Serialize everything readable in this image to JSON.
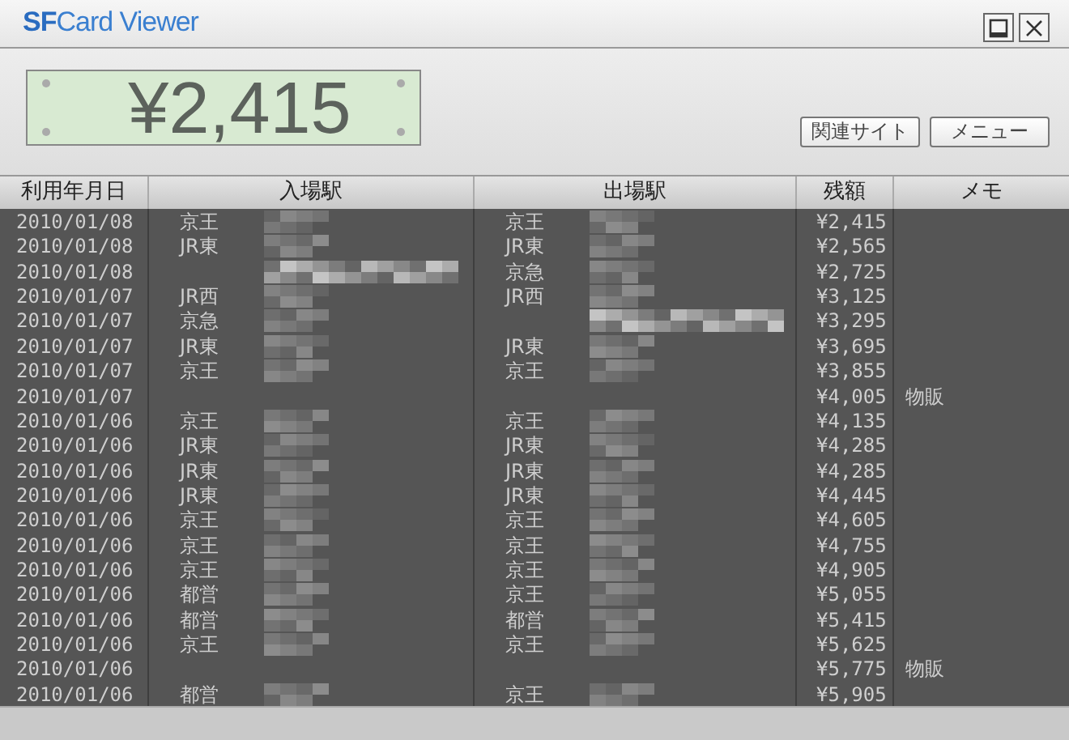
{
  "window": {
    "title_bold": "SF",
    "title_rest": "Card Viewer"
  },
  "balance": "¥2,415",
  "buttons": [
    "関連サイト",
    "メニュー"
  ],
  "table": {
    "columns": [
      "利用年月日",
      "入場駅",
      "出場駅",
      "残額",
      "メモ"
    ],
    "rows": [
      {
        "date": "2010/01/08",
        "entry": "京王",
        "entry_blurred": true,
        "entry_blur_wide": false,
        "exit": "京王",
        "exit_blurred": true,
        "exit_blur_wide": false,
        "balance": "¥2,415"
      },
      {
        "date": "2010/01/08",
        "entry": "JR東",
        "entry_blurred": true,
        "entry_blur_wide": false,
        "exit": "JR東",
        "exit_blurred": true,
        "exit_blur_wide": false,
        "balance": "¥2,565"
      },
      {
        "date": "2010/01/08",
        "entry_blurred": true,
        "entry_blur_wide": true,
        "exit": "京急",
        "exit_blurred": true,
        "exit_blur_wide": false,
        "balance": "¥2,725"
      },
      {
        "date": "2010/01/07",
        "entry": "JR西",
        "entry_blurred": true,
        "entry_blur_wide": false,
        "exit": "JR西",
        "exit_blurred": true,
        "exit_blur_wide": false,
        "balance": "¥3,125"
      },
      {
        "date": "2010/01/07",
        "entry": "京急",
        "entry_blurred": true,
        "entry_blur_wide": false,
        "exit_blurred": true,
        "exit_blur_wide": true,
        "balance": "¥3,295"
      },
      {
        "date": "2010/01/07",
        "entry": "JR東",
        "entry_blurred": true,
        "entry_blur_wide": false,
        "exit": "JR東",
        "exit_blurred": true,
        "exit_blur_wide": false,
        "balance": "¥3,695"
      },
      {
        "date": "2010/01/07",
        "entry": "京王",
        "entry_blurred": true,
        "entry_blur_wide": false,
        "exit": "京王",
        "exit_blurred": true,
        "exit_blur_wide": false,
        "balance": "¥3,855"
      },
      {
        "date": "2010/01/07",
        "entry_blurred": false,
        "exit_blurred": false,
        "balance": "¥4,005",
        "memo": "物販"
      },
      {
        "date": "2010/01/06",
        "entry": "京王",
        "entry_blurred": true,
        "entry_blur_wide": false,
        "exit": "京王",
        "exit_blurred": true,
        "exit_blur_wide": false,
        "balance": "¥4,135"
      },
      {
        "date": "2010/01/06",
        "entry": "JR東",
        "entry_blurred": true,
        "entry_blur_wide": false,
        "exit": "JR東",
        "exit_blurred": true,
        "exit_blur_wide": false,
        "balance": "¥4,285"
      },
      {
        "date": "2010/01/06",
        "entry": "JR東",
        "entry_blurred": true,
        "entry_blur_wide": false,
        "exit": "JR東",
        "exit_blurred": true,
        "exit_blur_wide": false,
        "balance": "¥4,285"
      },
      {
        "date": "2010/01/06",
        "entry": "JR東",
        "entry_blurred": true,
        "entry_blur_wide": false,
        "exit": "JR東",
        "exit_blurred": true,
        "exit_blur_wide": false,
        "balance": "¥4,445"
      },
      {
        "date": "2010/01/06",
        "entry": "京王",
        "entry_blurred": true,
        "entry_blur_wide": false,
        "exit": "京王",
        "exit_blurred": true,
        "exit_blur_wide": false,
        "balance": "¥4,605"
      },
      {
        "date": "2010/01/06",
        "entry": "京王",
        "entry_blurred": true,
        "entry_blur_wide": false,
        "exit": "京王",
        "exit_blurred": true,
        "exit_blur_wide": false,
        "balance": "¥4,755"
      },
      {
        "date": "2010/01/06",
        "entry": "京王",
        "entry_blurred": true,
        "entry_blur_wide": false,
        "exit": "京王",
        "exit_blurred": true,
        "exit_blur_wide": false,
        "balance": "¥4,905"
      },
      {
        "date": "2010/01/06",
        "entry": "都営",
        "entry_blurred": true,
        "entry_blur_wide": false,
        "exit": "京王",
        "exit_blurred": true,
        "exit_blur_wide": false,
        "balance": "¥5,055"
      },
      {
        "date": "2010/01/06",
        "entry": "都営",
        "entry_blurred": true,
        "entry_blur_wide": false,
        "exit": "都営",
        "exit_blurred": true,
        "exit_blur_wide": false,
        "balance": "¥5,415"
      },
      {
        "date": "2010/01/06",
        "entry": "京王",
        "entry_blurred": true,
        "entry_blur_wide": false,
        "exit": "京王",
        "exit_blurred": true,
        "exit_blur_wide": false,
        "balance": "¥5,625"
      },
      {
        "date": "2010/01/06",
        "entry_blurred": false,
        "exit_blurred": false,
        "balance": "¥5,775",
        "memo": "物販"
      },
      {
        "date": "2010/01/06",
        "entry": "都営",
        "entry_blurred": true,
        "entry_blur_wide": false,
        "exit": "京王",
        "exit_blurred": true,
        "exit_blur_wide": false,
        "balance": "¥5,905"
      }
    ]
  }
}
